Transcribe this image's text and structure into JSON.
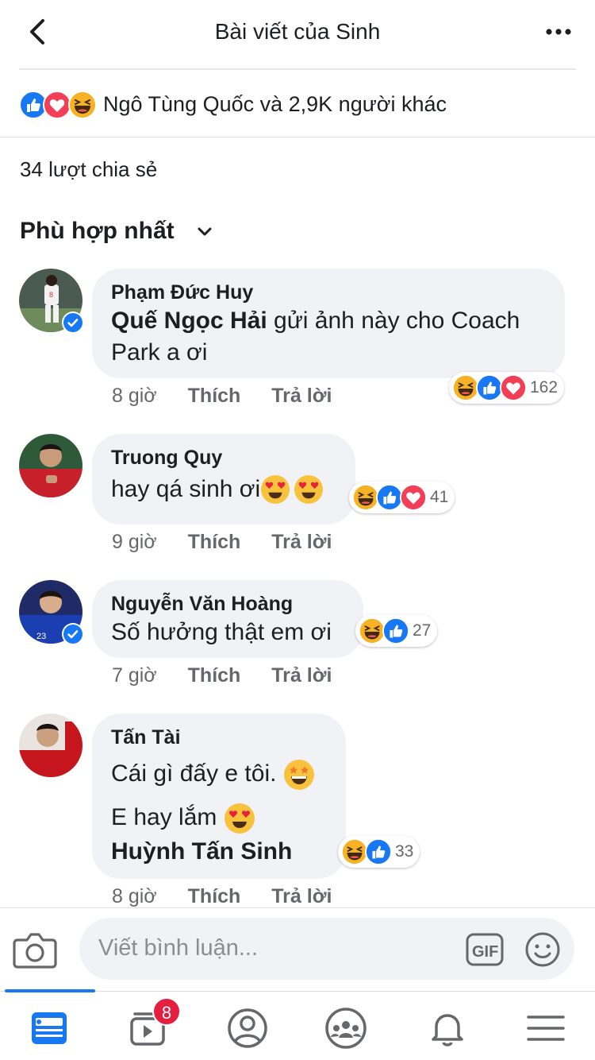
{
  "header": {
    "title": "Bài viết của Sinh",
    "back_icon": "chevron-left-icon",
    "more_icon": "more-horizontal-icon"
  },
  "reactions": {
    "icons": [
      "like-icon",
      "love-icon",
      "haha-icon"
    ],
    "text": "Ngô Tùng Quốc và 2,9K người khác"
  },
  "shares": {
    "text": "34 lượt chia sẻ"
  },
  "sort": {
    "label": "Phù hợp nhất"
  },
  "actions": {
    "like": "Thích",
    "reply": "Trả lời"
  },
  "comments": [
    {
      "author": "Phạm Đức Huy",
      "tag": "Quế Ngọc Hải",
      "text": " gửi ảnh này cho Coach Park a ơi",
      "time": "8 giờ",
      "reaction_count": "162",
      "verified": true
    },
    {
      "author": "Truong Quy",
      "text": "hay qá sinh ơi",
      "time": "9 giờ",
      "reaction_count": "41",
      "verified": false
    },
    {
      "author": "Nguyễn Văn Hoàng",
      "text": "Số hưởng thật em ơi",
      "time": "7 giờ",
      "reaction_count": "27",
      "verified": true
    },
    {
      "author": "Tấn Tài",
      "line1": "Cái gì đấy e tôi.",
      "line2": "E hay lắm",
      "tag": "Huỳnh Tấn Sinh",
      "time": "8 giờ",
      "reaction_count": "33",
      "verified": false
    }
  ],
  "composer": {
    "placeholder": "Viết bình luận...",
    "camera_icon": "camera-icon",
    "gif_icon": "gif-icon",
    "smile_icon": "smile-icon"
  },
  "tabbar": {
    "items": [
      "news-feed-icon",
      "watch-icon",
      "profile-icon",
      "groups-icon",
      "notifications-icon",
      "menu-icon"
    ],
    "watch_badge": "8"
  },
  "colors": {
    "accent": "#1877f2",
    "bubble": "#f0f2f5",
    "badge": "#e41e3f",
    "secondary_text": "#65676b"
  }
}
